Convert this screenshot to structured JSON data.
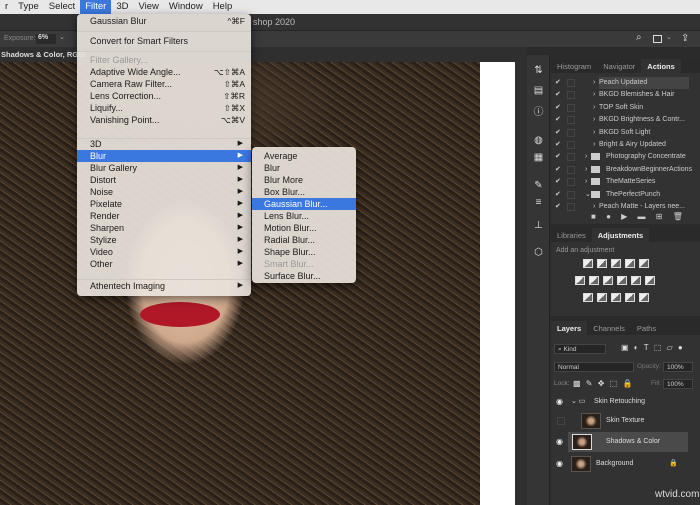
{
  "menubar": {
    "items": [
      "r",
      "Type",
      "Select",
      "Filter",
      "3D",
      "View",
      "Window",
      "Help"
    ]
  },
  "window": {
    "title": "shop 2020"
  },
  "options": {
    "exposure_label": "Exposure:",
    "exposure_value": "6%"
  },
  "document": {
    "tab": "Shadows & Color, RGB/"
  },
  "filter_menu": {
    "last_filter": "Gaussian Blur",
    "last_filter_shortcut": "^⌘F",
    "convert": "Convert for Smart Filters",
    "filter_gallery": "Filter Gallery...",
    "items": [
      {
        "label": "Adaptive Wide Angle...",
        "shortcut": "⌥⇧⌘A"
      },
      {
        "label": "Camera Raw Filter...",
        "shortcut": "⇧⌘A"
      },
      {
        "label": "Lens Correction...",
        "shortcut": "⇧⌘R"
      },
      {
        "label": "Liquify...",
        "shortcut": "⇧⌘X"
      },
      {
        "label": "Vanishing Point...",
        "shortcut": "⌥⌘V"
      }
    ],
    "submenus": [
      "3D",
      "Blur",
      "Blur Gallery",
      "Distort",
      "Noise",
      "Pixelate",
      "Render",
      "Sharpen",
      "Stylize",
      "Video",
      "Other"
    ],
    "plugin": "Athentech Imaging"
  },
  "blur_submenu": [
    "Average",
    "Blur",
    "Blur More",
    "Box Blur...",
    "Gaussian Blur...",
    "Lens Blur...",
    "Motion Blur...",
    "Radial Blur...",
    "Shape Blur...",
    "Smart Blur...",
    "Surface Blur..."
  ],
  "actions_panel": {
    "tabs": [
      "Histogram",
      "Navigator",
      "Actions"
    ],
    "rows": [
      {
        "name": "Peach Updated",
        "type": "action",
        "indent": 1
      },
      {
        "name": "BKGD Blemishes & Hair",
        "type": "action",
        "indent": 1
      },
      {
        "name": "TOP Soft Skin",
        "type": "action",
        "indent": 1
      },
      {
        "name": "BKGD Brightness & Contr...",
        "type": "action",
        "indent": 1
      },
      {
        "name": "BKGD Soft Light",
        "type": "action",
        "indent": 1
      },
      {
        "name": "Bright & Airy Updated",
        "type": "action",
        "indent": 1
      },
      {
        "name": "Photography Concentrate",
        "type": "set",
        "indent": 0
      },
      {
        "name": "BreakdownBeginnerActions",
        "type": "set",
        "indent": 0
      },
      {
        "name": "TheMatteSeries",
        "type": "set",
        "indent": 0
      },
      {
        "name": "ThePerfectPunch",
        "type": "set-open",
        "indent": 0
      },
      {
        "name": "Peach Matte - Layers nee...",
        "type": "action",
        "indent": 1
      }
    ]
  },
  "adjustments_panel": {
    "tabs": [
      "Libraries",
      "Adjustments"
    ],
    "hint": "Add an adjustment"
  },
  "layers_panel": {
    "tabs": [
      "Layers",
      "Channels",
      "Paths"
    ],
    "filter": "Kind",
    "blend_mode": "Normal",
    "opacity_label": "Opacity:",
    "opacity": "100%",
    "lock_label": "Lock:",
    "fill_label": "Fill:",
    "fill": "100%",
    "layers": [
      {
        "name": "Skin Retouching",
        "type": "group",
        "visible": true
      },
      {
        "name": "Skin Texture",
        "type": "layer",
        "visible": false
      },
      {
        "name": "Shadows & Color",
        "type": "layer",
        "visible": true,
        "selected": true
      },
      {
        "name": "Background",
        "type": "layer",
        "visible": true,
        "locked": true
      }
    ]
  },
  "watermark": "wtvid.com"
}
